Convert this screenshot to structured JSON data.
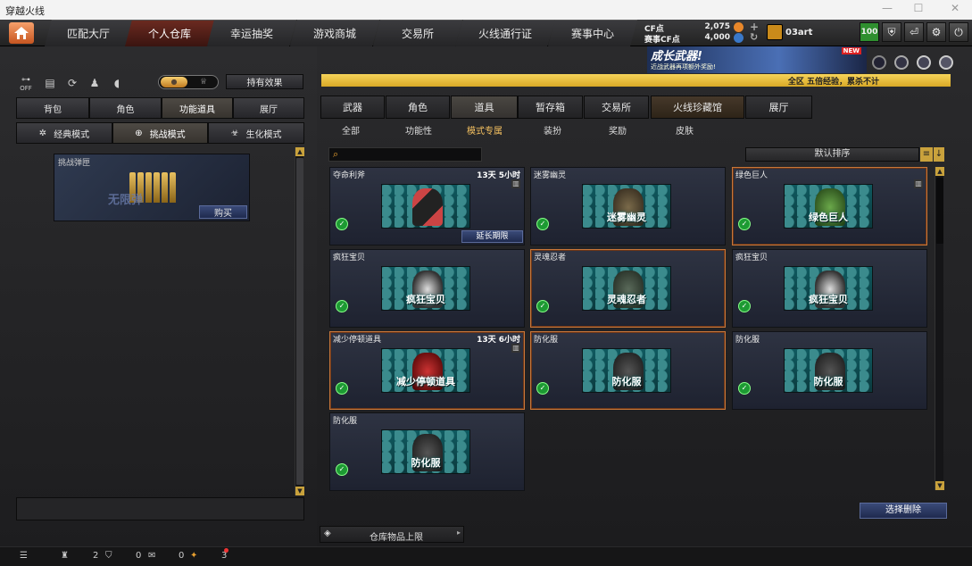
{
  "window": {
    "title": "穿越火线",
    "controls": [
      "—",
      "☐",
      "✕"
    ]
  },
  "topnav": {
    "tabs": [
      "匹配大厅",
      "个人仓库",
      "幸运抽奖",
      "游戏商城",
      "交易所",
      "火线通行证",
      "赛事中心"
    ],
    "active_tab": "个人仓库",
    "cf_points_label": "CF点",
    "cf_points_value": "2,075",
    "match_cf_label": "赛事CF点",
    "match_cf_value": "4,000",
    "username": "03art",
    "level_badge": "100",
    "icons": [
      "shield-icon",
      "exit-icon",
      "gear-icon",
      "power-icon"
    ]
  },
  "banner": {
    "title": "成长武器!",
    "subtitle": "近战武器再项额外奖励!",
    "new_tag": "NEW",
    "ticker_text": "全区 五倍经验，累杀不计"
  },
  "left": {
    "quick_icons": [
      "off-toggle-icon",
      "stats-icon",
      "refresh-icon",
      "person-icon",
      "mouse-icon"
    ],
    "off_label": "OFF",
    "holding_effect_label": "持有效果",
    "tabs": [
      "背包",
      "角色",
      "功能道具",
      "展厅"
    ],
    "active_tab": "功能道具",
    "modes": [
      {
        "icon": "classic-icon",
        "label": "经典模式"
      },
      {
        "icon": "challenge-icon",
        "label": "挑战模式"
      },
      {
        "icon": "biohazard-icon",
        "label": "生化模式"
      }
    ],
    "active_mode": "挑战模式",
    "slot": {
      "label": "挑战弹匣",
      "watermark": "无限弹",
      "buy_label": "购买"
    }
  },
  "right": {
    "tabs": [
      "武器",
      "角色",
      "道具",
      "暂存箱",
      "交易所",
      "火线珍藏馆",
      "展厅"
    ],
    "active_tab": "道具",
    "filters": [
      "全部",
      "功能性",
      "模式专属",
      "装扮",
      "奖励",
      "皮肤"
    ],
    "active_filter": "模式专属",
    "search_placeholder": "",
    "sort_label": "默认排序",
    "items": [
      {
        "name": "夺命利斧",
        "time": "13天 5小时",
        "trash": true,
        "caption": "",
        "extend": "延长期限",
        "highlight": false,
        "kind": "axe"
      },
      {
        "name": "迷雾幽灵",
        "time": "",
        "trash": false,
        "caption": "迷雾幽灵",
        "extend": "",
        "highlight": false,
        "kind": "ghost"
      },
      {
        "name": "绿色巨人",
        "time": "",
        "trash": true,
        "caption": "绿色巨人",
        "extend": "",
        "highlight": true,
        "kind": "giant"
      },
      {
        "name": "疯狂宝贝",
        "time": "",
        "trash": false,
        "caption": "疯狂宝贝",
        "extend": "",
        "highlight": false,
        "kind": "baby"
      },
      {
        "name": "灵魂忍者",
        "time": "",
        "trash": false,
        "caption": "灵魂忍者",
        "extend": "",
        "highlight": true,
        "kind": "ninja"
      },
      {
        "name": "疯狂宝贝",
        "time": "",
        "trash": false,
        "caption": "疯狂宝贝",
        "extend": "",
        "highlight": false,
        "kind": "baby"
      },
      {
        "name": "减少停顿道具",
        "time": "13天 6小时",
        "trash": true,
        "caption": "减少停顿道具",
        "extend": "",
        "highlight": true,
        "kind": "mine"
      },
      {
        "name": "防化服",
        "time": "",
        "trash": false,
        "caption": "防化服",
        "extend": "",
        "highlight": true,
        "kind": "suit"
      },
      {
        "name": "防化服",
        "time": "",
        "trash": false,
        "caption": "防化服",
        "extend": "",
        "highlight": false,
        "kind": "suit"
      },
      {
        "name": "防化服",
        "time": "",
        "trash": false,
        "caption": "防化服",
        "extend": "",
        "highlight": false,
        "kind": "suit"
      }
    ],
    "bulk_delete_label": "选择删除",
    "capacity_label": "仓库物品上限"
  },
  "statusbar": {
    "friends_count": "2",
    "messages_count": "0",
    "gifts_count": "0",
    "notify_count": "3"
  },
  "colors": {
    "accent": "#c8773a",
    "tab_active": "#6b2a20",
    "ticker": "#f2c84b",
    "green_badge": "#1d9a33"
  }
}
